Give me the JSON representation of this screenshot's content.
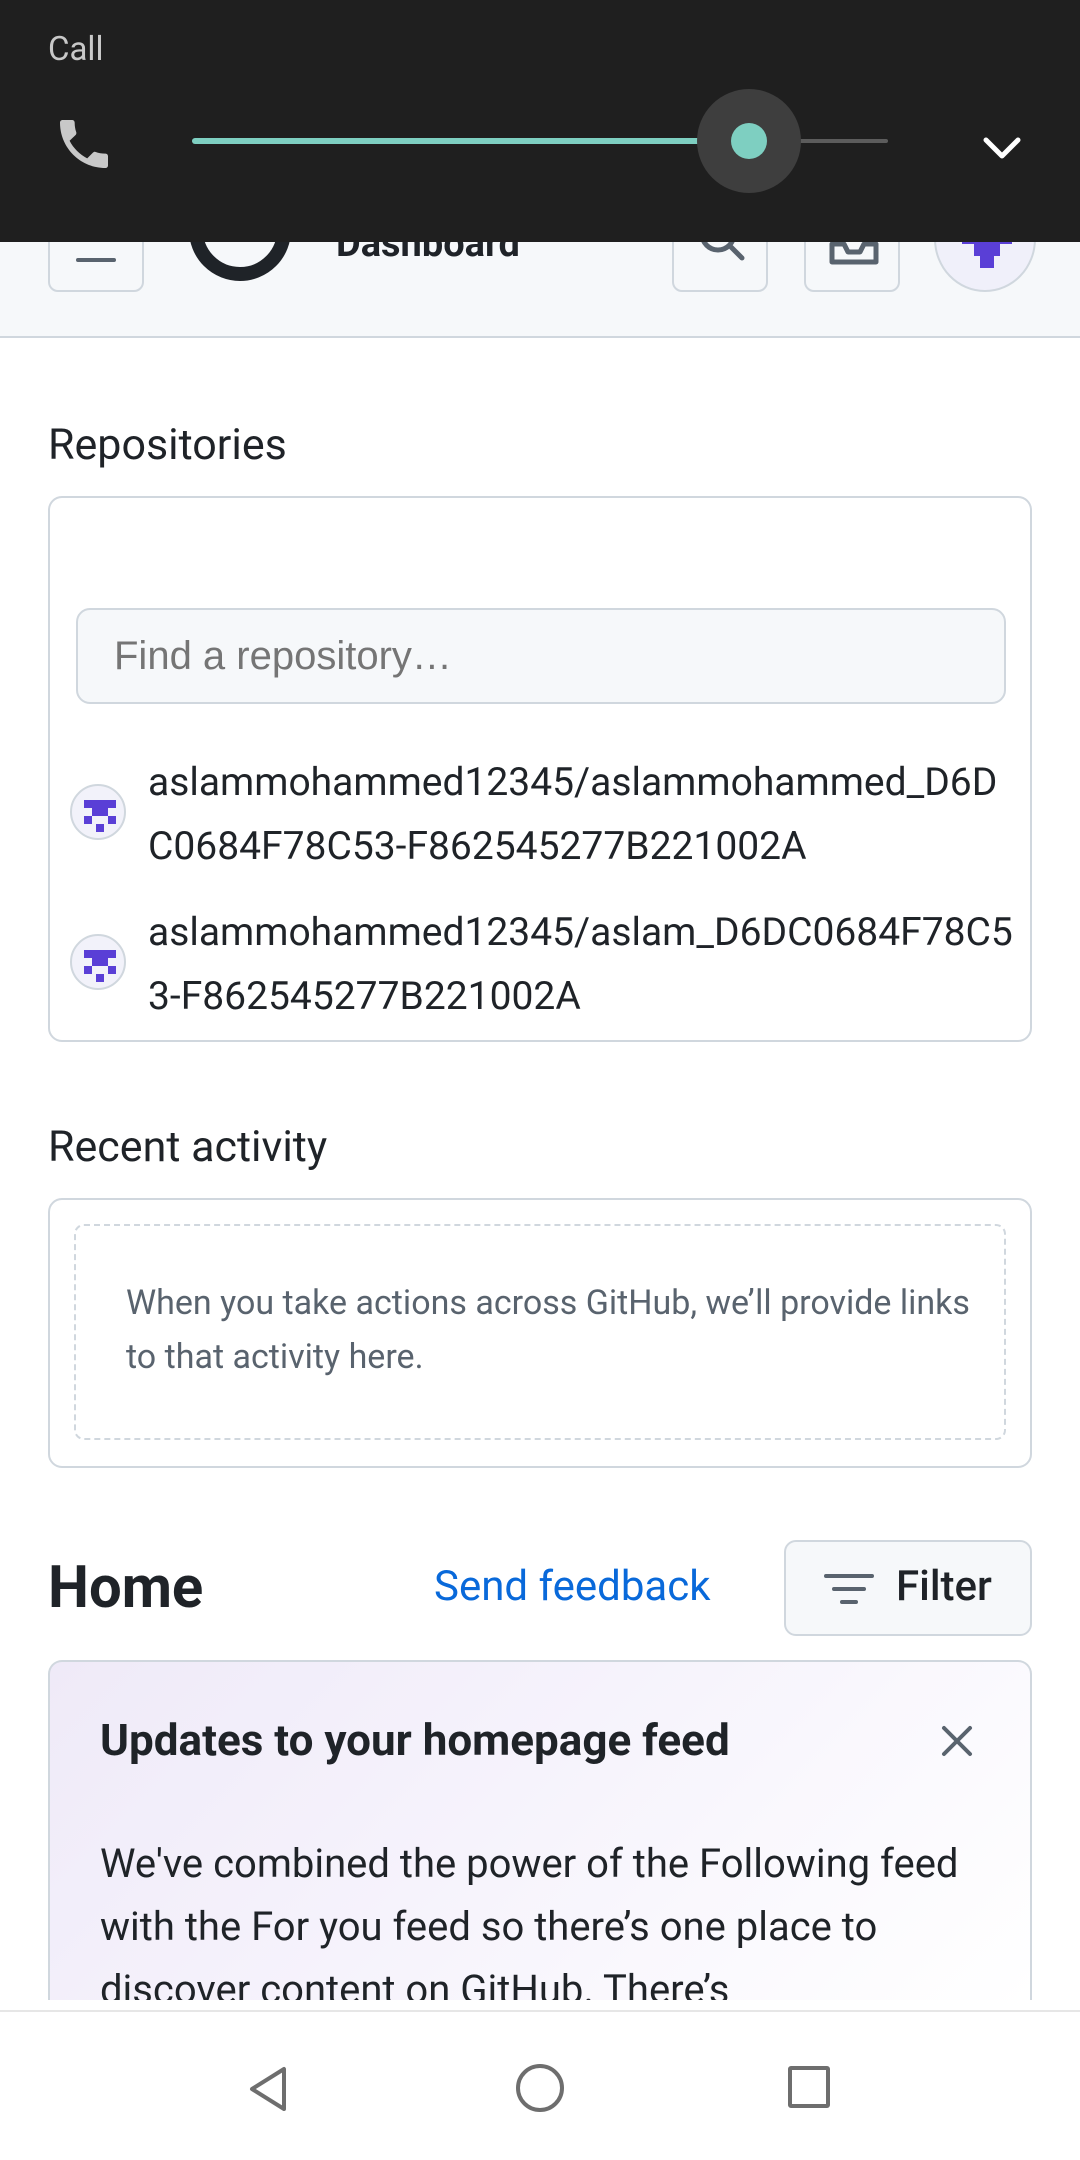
{
  "volume_panel": {
    "label": "Call",
    "level_percent": 80,
    "colors": {
      "background": "#1f1f1f",
      "accent": "#7ecfc1"
    },
    "icons": {
      "stream": "phone-icon",
      "expand": "chevron-down-icon"
    }
  },
  "header": {
    "title": "Dashboard",
    "icons": {
      "menu": "menu-icon",
      "logo": "github-logo-icon",
      "search": "search-icon",
      "inbox": "inbox-icon",
      "avatar": "identicon-avatar"
    }
  },
  "repositories": {
    "heading": "Repositories",
    "search_placeholder": "Find a repository…",
    "items": [
      {
        "name": "aslammohammed12345/aslammohammed_D6DC0684F78C53-F862545277B221002A"
      },
      {
        "name": "aslammohammed12345/aslam_D6DC0684F78C53-F862545277B221002A"
      }
    ]
  },
  "recent_activity": {
    "heading": "Recent activity",
    "empty_text": "When you take actions across GitHub, we’ll provide links to that activity here."
  },
  "home": {
    "heading": "Home",
    "feedback_link": "Send feedback",
    "filter_label": "Filter"
  },
  "updates_card": {
    "title": "Updates to your homepage feed",
    "body": "We've combined the power of the Following feed with the For you feed so there’s one place to discover content on GitHub. There’s"
  },
  "colors": {
    "link": "#0969da",
    "border": "#d0d7de",
    "muted_text": "#59636e",
    "identicon": "#5a3fd6"
  },
  "nav_bar": {
    "icons": [
      "back-icon",
      "home-icon",
      "recents-icon"
    ]
  }
}
